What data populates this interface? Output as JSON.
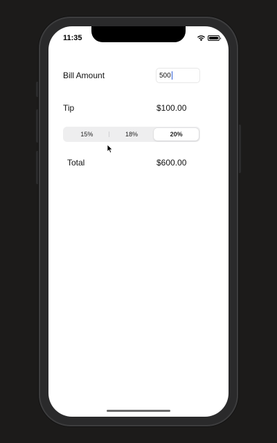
{
  "status_bar": {
    "time": "11:35",
    "wifi_icon": "wifi-icon",
    "battery_icon": "battery-icon"
  },
  "form": {
    "bill_label": "Bill Amount",
    "bill_value": "500",
    "tip_label": "Tip",
    "tip_value": "$100.00",
    "total_label": "Total",
    "total_value": "$600.00"
  },
  "tip_options": [
    "15%",
    "18%",
    "20%"
  ],
  "selected_tip": "20%",
  "colors": {
    "background": "#1c1b1a",
    "screen": "#ffffff",
    "caret": "#2a5bd7"
  }
}
